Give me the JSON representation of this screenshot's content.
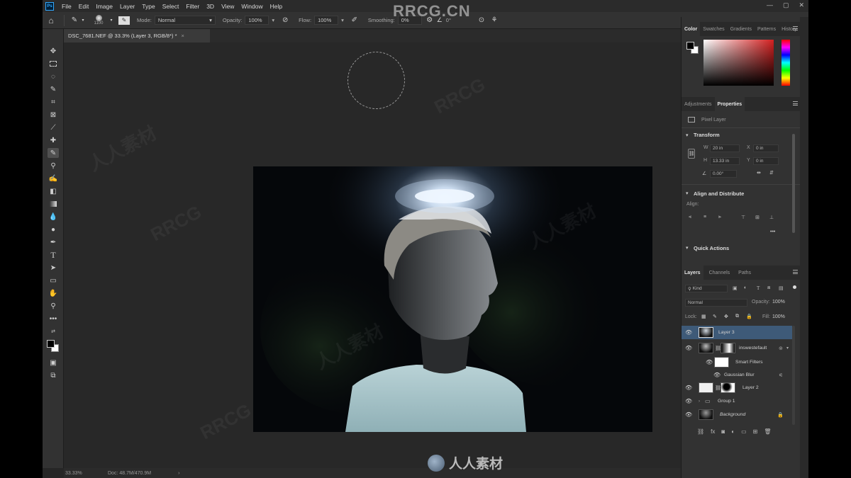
{
  "menu": {
    "logo": "Ps",
    "items": [
      "File",
      "Edit",
      "Image",
      "Layer",
      "Type",
      "Select",
      "Filter",
      "3D",
      "View",
      "Window",
      "Help"
    ],
    "window_controls": [
      "—",
      "▢",
      "✕"
    ]
  },
  "options": {
    "brush_size": "1100",
    "mode_label": "Mode:",
    "mode_value": "Normal",
    "opacity_label": "Opacity:",
    "opacity_value": "100%",
    "flow_label": "Flow:",
    "flow_value": "100%",
    "smoothing_label": "Smoothing:",
    "smoothing_value": "0%",
    "angle_value": "0°"
  },
  "document": {
    "tab_title": "DSC_7681.NEF @ 33.3% (Layer 3, RGB/8*) *",
    "tab_close": "×"
  },
  "status": {
    "zoom": "33.33%",
    "doc_info": "Doc: 48.7M/470.9M",
    "arrow": "›"
  },
  "color_panel": {
    "tabs": [
      "Color",
      "Swatches",
      "Gradients",
      "Patterns",
      "History"
    ],
    "active_tab": "Color",
    "hue_color": "#d42020"
  },
  "properties_panel": {
    "tabs": [
      "Adjustments",
      "Properties"
    ],
    "active_tab": "Properties",
    "pixel_layer": "Pixel Layer",
    "transform_title": "Transform",
    "w_label": "W",
    "w_value": "20 in",
    "h_label": "H",
    "h_value": "13.33 in",
    "x_label": "X",
    "x_value": "0 in",
    "y_label": "Y",
    "y_value": "0 in",
    "angle_value": "0.00°",
    "align_title": "Align and Distribute",
    "align_label": "Align:",
    "more": "•••",
    "quick_actions_title": "Quick Actions"
  },
  "layers_panel": {
    "tabs": [
      "Layers",
      "Channels",
      "Paths"
    ],
    "active_tab": "Layers",
    "filter_kind": "Kind",
    "blend_mode": "Normal",
    "opacity_label": "Opacity:",
    "opacity_value": "100%",
    "lock_label": "Lock:",
    "fill_label": "Fill:",
    "fill_value": "100%",
    "layers": [
      {
        "name": "Layer 3",
        "selected": true
      },
      {
        "name": "inswestefault",
        "selected": false
      },
      {
        "name": "Smart Filters",
        "selected": false
      },
      {
        "name": "Gaussian Blur",
        "selected": false
      },
      {
        "name": "Layer 2",
        "selected": false
      },
      {
        "name": "Group 1",
        "selected": false
      },
      {
        "name": "Background",
        "selected": false
      }
    ],
    "footer_icons": [
      "link-icon",
      "fx-icon",
      "mask-icon",
      "adjustment-icon",
      "folder-icon",
      "new-layer-icon",
      "trash-icon"
    ]
  },
  "watermark": {
    "top": "RRCG.CN",
    "bottom": "人人素材",
    "faint_1": "人人素材",
    "faint_2": "RRCG"
  }
}
